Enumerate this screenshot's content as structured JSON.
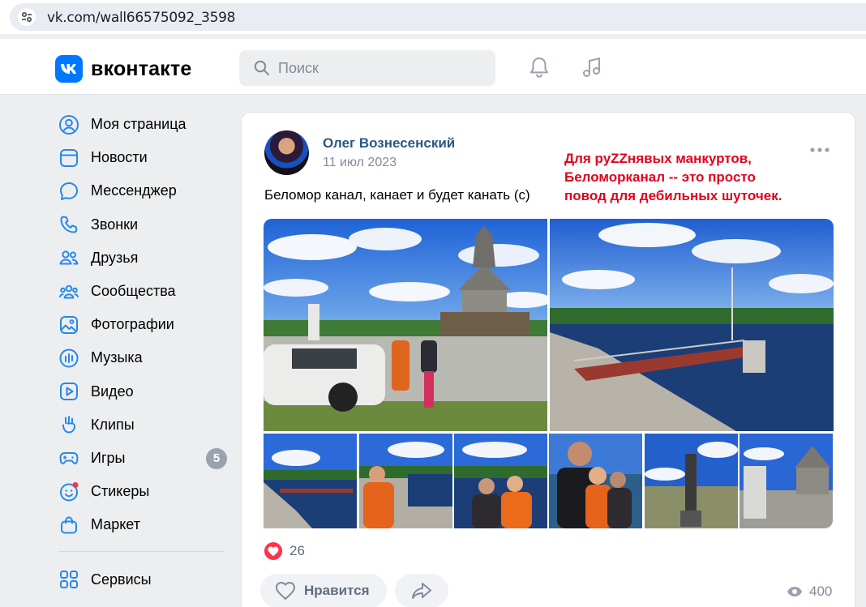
{
  "browser": {
    "url": "vk.com/wall66575092_3598"
  },
  "header": {
    "logo_text": "вконтакте",
    "search_placeholder": "Поиск",
    "icons": [
      "bell-icon",
      "music-icon"
    ],
    "accent": "#0077ff"
  },
  "sidebar": {
    "items": [
      {
        "label": "Моя страница",
        "icon": "user-circle-icon"
      },
      {
        "label": "Новости",
        "icon": "news-icon"
      },
      {
        "label": "Мессенджер",
        "icon": "chat-icon"
      },
      {
        "label": "Звонки",
        "icon": "phone-icon"
      },
      {
        "label": "Друзья",
        "icon": "friends-icon"
      },
      {
        "label": "Сообщества",
        "icon": "communities-icon"
      },
      {
        "label": "Фотографии",
        "icon": "photo-icon"
      },
      {
        "label": "Музыка",
        "icon": "music-bars-icon"
      },
      {
        "label": "Видео",
        "icon": "video-icon"
      },
      {
        "label": "Клипы",
        "icon": "clips-icon"
      },
      {
        "label": "Игры",
        "icon": "gamepad-icon",
        "badge": "5"
      },
      {
        "label": "Стикеры",
        "icon": "sticker-icon"
      },
      {
        "label": "Маркет",
        "icon": "market-bag-icon"
      }
    ],
    "services_label": "Сервисы"
  },
  "post": {
    "author": "Олег Вознесенский",
    "date": "11 июл 2023",
    "text": "Беломор канал, канает и будет канать (с)",
    "overlay_text": "Для руZZнявых манкуртов,\nБеломорканал -- это просто\nповод для дебильных шуточек.",
    "overlay_color": "#e3001b",
    "likes": "26",
    "like_label": "Нравится",
    "views": "400",
    "photo_count": 8
  }
}
